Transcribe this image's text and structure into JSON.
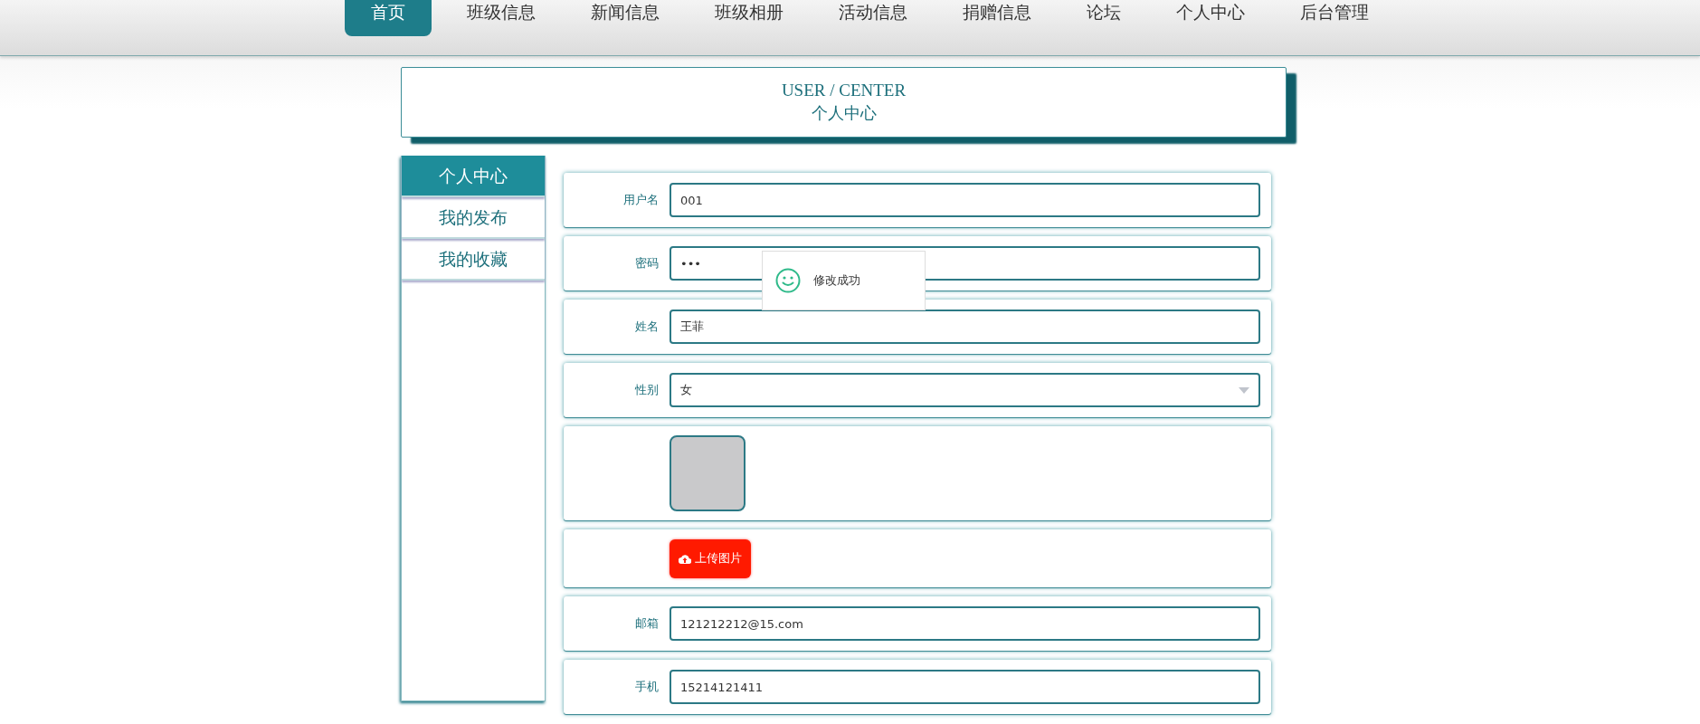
{
  "nav": [
    {
      "label": "首页",
      "selected": true
    },
    {
      "label": "班级信息",
      "selected": false
    },
    {
      "label": "新闻信息",
      "selected": false
    },
    {
      "label": "班级相册",
      "selected": false
    },
    {
      "label": "活动信息",
      "selected": false
    },
    {
      "label": "捐赠信息",
      "selected": false
    },
    {
      "label": "论坛",
      "selected": false
    },
    {
      "label": "个人中心",
      "selected": false
    },
    {
      "label": "后台管理",
      "selected": false
    }
  ],
  "header": {
    "title_en": "USER / CENTER",
    "title": "个人中心"
  },
  "sidebar": {
    "items": [
      {
        "label": "个人中心",
        "selected": true
      },
      {
        "label": "我的发布",
        "selected": false
      },
      {
        "label": "我的收藏",
        "selected": false
      }
    ]
  },
  "form": {
    "fields": [
      {
        "kind": "text",
        "label": "用户名",
        "value": "001"
      },
      {
        "kind": "password",
        "label": "密码",
        "value": "•••"
      },
      {
        "kind": "text",
        "label": "姓名",
        "value": "王菲"
      },
      {
        "kind": "select",
        "label": "性别",
        "value": "女"
      },
      {
        "kind": "image"
      },
      {
        "kind": "upload",
        "button": "上传图片"
      },
      {
        "kind": "text",
        "label": "邮箱",
        "value": "121212212@15.com"
      },
      {
        "kind": "text",
        "label": "手机",
        "value": "15214121411"
      }
    ]
  },
  "toast": {
    "message": "修改成功"
  }
}
